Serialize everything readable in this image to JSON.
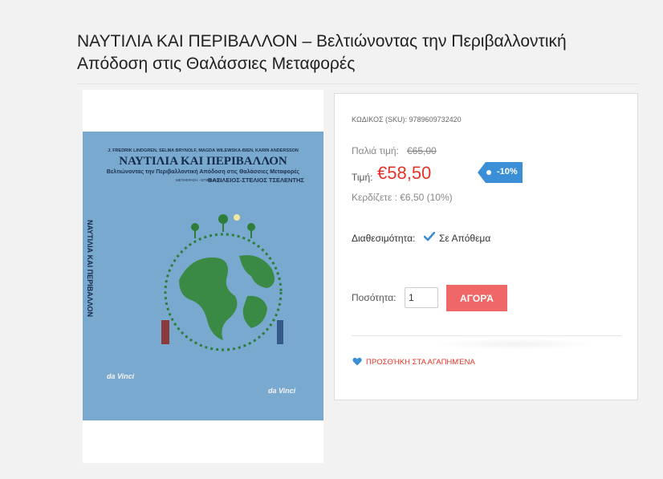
{
  "product": {
    "title": "ΝΑΥΤΙΛΙΑ ΚΑΙ ΠΕΡΙΒΑΛΛΟΝ – Βελτιώνοντας την Περιβαλλοντική Απόδοση στις Θαλάσσιες Μεταφορές"
  },
  "cover": {
    "authors": "J. FREDRIK LINDGREN, SELMA BRYNOLF, MAGDA WILEWSKA-BIEN, KARIN ANDERSSON",
    "title": "ΝΑΥΤΙΛΙΑ ΚΑΙ ΠΕΡΙΒΑΛΛΟΝ",
    "subtitle": "Βελτιώνοντας την Περιβαλλοντική Απόδοση στις Θαλάσσιες Μεταφορές",
    "translator_label": "ΜΕΤΑΦΡΑΣΗ - ΕΠΙΜΕΛΕΙΑ",
    "translator_name": "ΒΑΣΙΛΕΙΟΣ-ΣΤΕΛΙΟΣ ΤΣΕΛΕΝΤΗΣ",
    "spine_title": "ΝΑΥΤΙΛΙΑ ΚΑΙ ΠΕΡΙΒΑΛΛΟΝ",
    "publisher": "da Vinci",
    "background_color": "#7aa9d0"
  },
  "details": {
    "sku_label": "ΚΩΔΙΚΟΣ (SKU):",
    "sku_value": "9789609732420",
    "sku_text": "ΚΩΔΙΚΟΣ (SKU): 9789609732420",
    "old_price_label": "Παλιά τιμή:",
    "old_price": "€65,00",
    "price_label": "Τιμή:",
    "price": "€58,50",
    "discount_badge": "-10%",
    "savings": "Κερδίζετε : €6,50 (10%)",
    "availability_label": "Διαθεσιμότητα:",
    "availability_value": "Σε Απόθεμα",
    "quantity_label": "Ποσότητα:",
    "quantity_value": "1",
    "buy_button": "ΑΓΟΡΆ",
    "wishlist_link": "ΠΡΟΣΘΉΚΗ ΣΤΑ ΑΓΑΠΗΜΈΝΑ"
  },
  "colors": {
    "price": "#e4342a",
    "buy_button": "#f06767",
    "badge": "#3a8fd6",
    "check": "#3a8fd6",
    "heart": "#3a8fd6"
  },
  "icons": {
    "check": "check-icon",
    "heart": "heart-icon",
    "badge_dot": "dot-icon"
  }
}
